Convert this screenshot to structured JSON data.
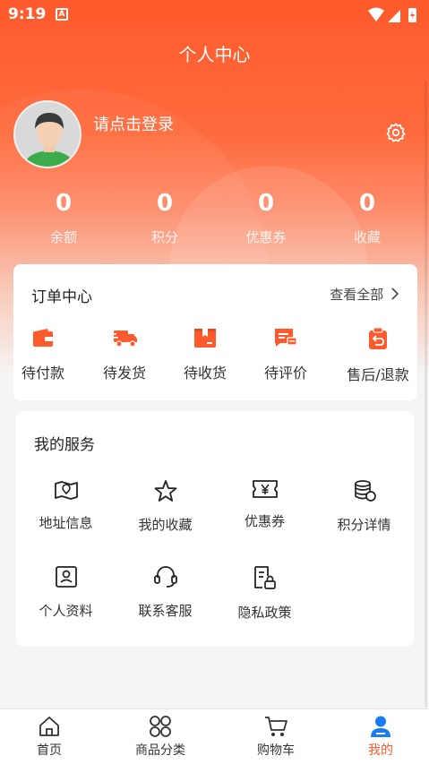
{
  "status": {
    "time": "9:19",
    "notif": "A"
  },
  "header": {
    "title": "个人中心"
  },
  "user": {
    "login_prompt": "请点击登录"
  },
  "stats": [
    {
      "value": "0",
      "label": "余额"
    },
    {
      "value": "0",
      "label": "积分"
    },
    {
      "value": "0",
      "label": "优惠券"
    },
    {
      "value": "0",
      "label": "收藏"
    }
  ],
  "orders": {
    "title": "订单中心",
    "view_all": "查看全部",
    "items": [
      {
        "label": "待付款",
        "icon": "wallet-icon"
      },
      {
        "label": "待发货",
        "icon": "truck-icon"
      },
      {
        "label": "待收货",
        "icon": "package-icon"
      },
      {
        "label": "待评价",
        "icon": "review-icon"
      },
      {
        "label": "售后/退款",
        "icon": "refund-icon"
      }
    ]
  },
  "services": {
    "title": "我的服务",
    "items": [
      {
        "label": "地址信息",
        "icon": "map-icon"
      },
      {
        "label": "我的收藏",
        "icon": "star-icon"
      },
      {
        "label": "优惠券",
        "icon": "coupon-icon"
      },
      {
        "label": "积分详情",
        "icon": "coins-icon"
      },
      {
        "label": "个人资料",
        "icon": "profile-icon"
      },
      {
        "label": "联系客服",
        "icon": "headset-icon"
      },
      {
        "label": "隐私政策",
        "icon": "privacy-doc-icon"
      }
    ]
  },
  "tabbar": [
    {
      "label": "首页",
      "icon": "home-icon"
    },
    {
      "label": "商品分类",
      "icon": "category-icon"
    },
    {
      "label": "购物车",
      "icon": "cart-icon"
    },
    {
      "label": "我的",
      "icon": "user-icon",
      "active": true
    }
  ],
  "colors": {
    "accent": "#ff5a2c",
    "active_tab": "#1a7cf5",
    "order_icon": "#ff5a2c"
  }
}
